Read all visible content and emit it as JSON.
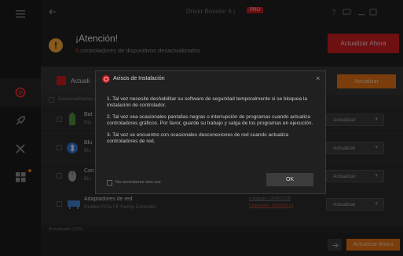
{
  "titlebar": {
    "app_title": "Driver Booster 6 |",
    "pro_badge": "PRO"
  },
  "alert": {
    "icon_glyph": "!",
    "title": "¡Atención!",
    "count": "5",
    "subtitle": " controladores de dispositivos desactualizados",
    "update_all_label": "Actualizar Ahora"
  },
  "update_section": {
    "label": "Actuali",
    "update_button": "Actualizar",
    "group_label": "Desactualizados (5)"
  },
  "rows": [
    {
      "title": "Bat",
      "subtitle": "Bat",
      "meta1": "",
      "meta2": "",
      "action": "Actualizar"
    },
    {
      "title": "Blu",
      "subtitle": "Blu",
      "meta1": "",
      "meta2": "",
      "action": "Actualizar"
    },
    {
      "title": "Con",
      "subtitle": "Blu",
      "meta1": "",
      "meta2": "",
      "action": "Actualizar"
    },
    {
      "title": "Adaptadores de red",
      "subtitle": "Realtek PCIe FE Family Controller",
      "meta1": "Instalado: 11/09/2018",
      "meta2": "Disponible: 28/08/2018",
      "action": "Actualizar"
    }
  ],
  "footer": {
    "label": "Actualizado (120)",
    "update_all_label": "Actualizar Ahora"
  },
  "dialog": {
    "title": "Avisos de Instalación",
    "close_glyph": "×",
    "items": [
      "1. Tal vez necesite deshabilitar su software de seguridad temporalmente si se bloquea la instalación de controlador.",
      "2. Tal vez vea ocasionales pantallas negras o interrupción de programas cuando actualiza controladores gráficos. Por favor, guarde su trabajo y salga de los programas en ejecución.",
      "3. Tal vez se encuentre con ocasionales desconexiones de red cuando actualiza controladores de red."
    ],
    "checkbox_label": "No recordarme otra vez",
    "ok_label": "OK"
  },
  "colors": {
    "accent_red": "#c81d22",
    "accent_orange": "#df6f15",
    "alert_icon": "#f2a23a"
  },
  "icons": [
    "menu-icon",
    "back-icon",
    "help-icon",
    "chat-icon",
    "minimize-icon",
    "close-icon",
    "lifebuoy-icon",
    "rocket-icon",
    "tools-icon",
    "apps-icon",
    "battery-icon",
    "bluetooth-icon",
    "mouse-icon",
    "network-icon",
    "share-icon"
  ]
}
